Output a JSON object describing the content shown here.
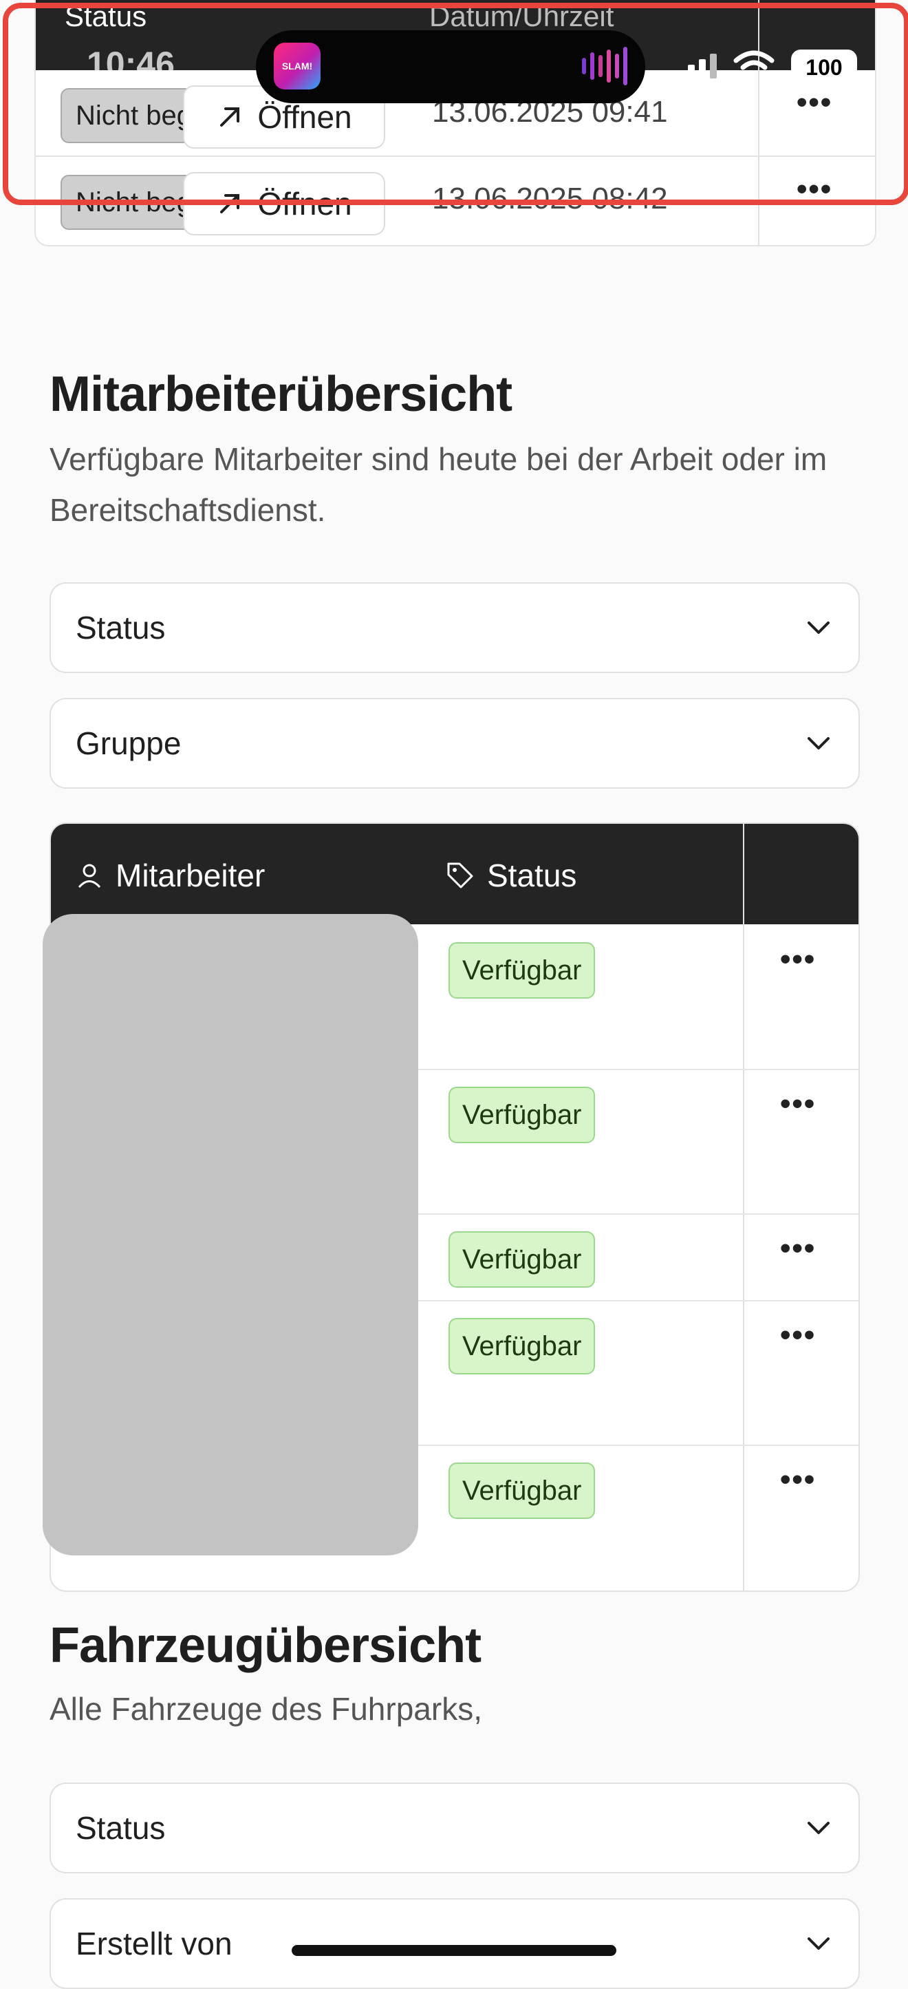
{
  "status_bar": {
    "time": "10:46",
    "battery": "100",
    "app_badge": "SLAM!"
  },
  "top_table": {
    "headers": {
      "status": "Status",
      "datetime": "Datum/Uhrzeit"
    },
    "rows": [
      {
        "status": "Nicht beg",
        "open_label": "Öffnen",
        "date": "13.06.2025 09:41",
        "more": "•••"
      },
      {
        "status": "Nicht beg",
        "open_label": "Öffnen",
        "date": "13.06.2025 08:42",
        "more": "•••"
      }
    ]
  },
  "employees": {
    "title": "Mitarbeiterübersicht",
    "subtitle": "Verfügbare Mitarbeiter sind heute bei der Arbeit oder im Bereitschaftsdienst.",
    "filters": {
      "status": "Status",
      "group": "Gruppe"
    },
    "headers": {
      "employee": "Mitarbeiter",
      "status": "Status"
    },
    "rows": [
      {
        "status": "Verfügbar",
        "more": "•••"
      },
      {
        "status": "Verfügbar",
        "more": "•••"
      },
      {
        "status": "Verfügbar",
        "more": "•••"
      },
      {
        "status": "Verfügbar",
        "more": "•••"
      },
      {
        "status": "Verfügbar",
        "more": "•••"
      }
    ]
  },
  "vehicles": {
    "title": "Fahrzeugübersicht",
    "subtitle": "Alle Fahrzeuge des Fuhrparks,",
    "filters": {
      "status": "Status",
      "created_by": "Erstellt von"
    }
  },
  "colors": {
    "header_dark": "#242424",
    "badge_green": "#d7f5c9",
    "badge_grey": "#cfcfcf",
    "highlight": "#e8453c"
  }
}
